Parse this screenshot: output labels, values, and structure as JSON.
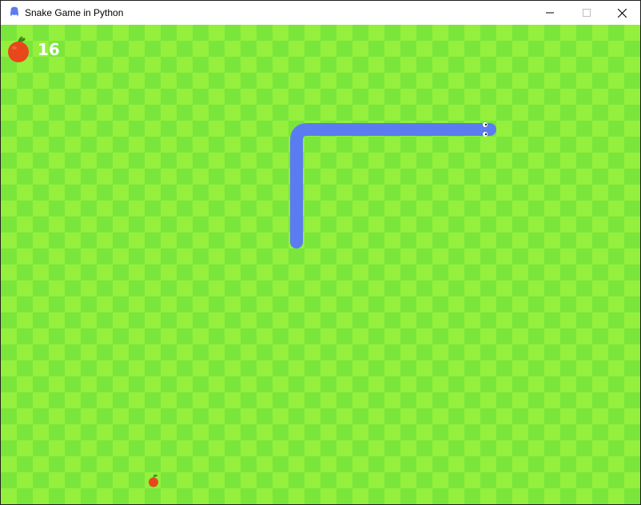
{
  "window": {
    "title": "Snake Game in Python",
    "app_icon": "python-snake-icon",
    "controls": {
      "minimize_icon": "minimize-icon",
      "maximize_icon": "maximize-icon",
      "close_icon": "close-icon"
    }
  },
  "game": {
    "score": "16",
    "score_icon": "apple-icon",
    "food_icon": "apple-icon",
    "snake_direction": "right",
    "colors": {
      "grass_dark": "#7ae63c",
      "grass_light": "#94f03c",
      "snake": "#5b7cf0",
      "apple": "#e8471c",
      "apple_leaf": "#3a8a1e",
      "score_text": "#ffffff"
    }
  }
}
